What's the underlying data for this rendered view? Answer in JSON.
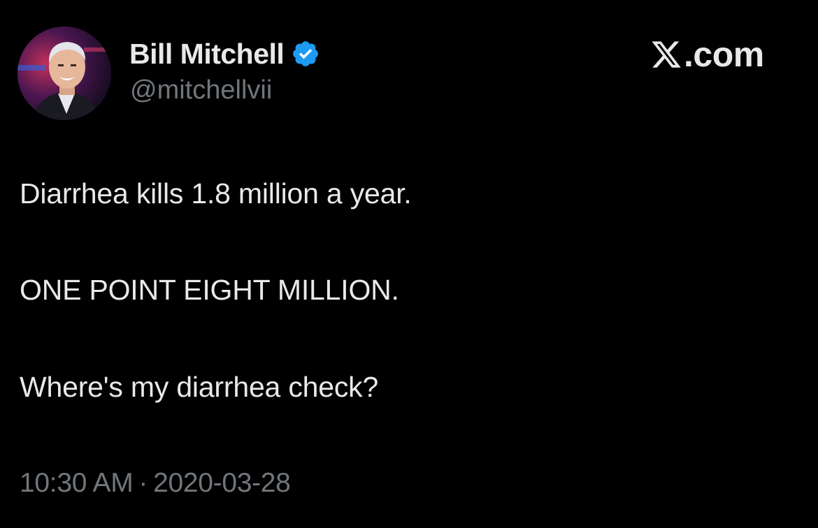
{
  "author": {
    "display_name": "Bill Mitchell",
    "handle": "@mitchellvii",
    "verified": true
  },
  "watermark": {
    "logo_icon": "x-logo-icon",
    "text": ".com"
  },
  "tweet": {
    "lines": [
      "Diarrhea kills 1.8 million a year.",
      "ONE POINT EIGHT MILLION.",
      "Where's my diarrhea check?"
    ]
  },
  "meta": {
    "time": "10:30 AM",
    "separator": "·",
    "date": "2020-03-28"
  },
  "colors": {
    "background": "#000000",
    "primary_text": "#e7e9ea",
    "secondary_text": "#71767b",
    "verified_badge": "#1d9bf0"
  }
}
